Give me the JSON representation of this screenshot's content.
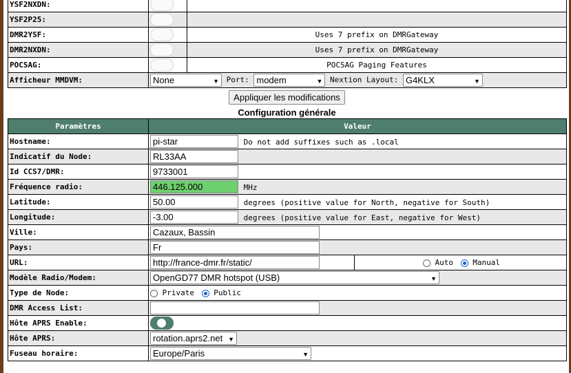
{
  "top_table": {
    "rows": [
      {
        "label": "YSF2NXDN:",
        "description": ""
      },
      {
        "label": "YSF2P25:",
        "description": ""
      },
      {
        "label": "DMR2YSF:",
        "description": "Uses 7 prefix on DMRGateway"
      },
      {
        "label": "DMR2NXDN:",
        "description": "Uses 7 prefix on DMRGateway"
      },
      {
        "label": "POCSAG:",
        "description": "POCSAG Paging Features"
      }
    ],
    "display": {
      "label": "Afficheur MMDVM:",
      "display_value": "None",
      "port_label": "Port:",
      "port_value": "modem",
      "nextion_label": "Nextion Layout:",
      "nextion_value": "G4KLX"
    }
  },
  "apply_button": "Appliquer les modifications",
  "section_title": "Configuration générale",
  "config": {
    "header_param": "Paramètres",
    "header_value": "Valeur",
    "hostname": {
      "label": "Hostname:",
      "value": "pi-star",
      "note": "Do not add suffixes such as .local"
    },
    "callsign": {
      "label": "Indicatif du Node:",
      "value": "RL33AA"
    },
    "ccs7": {
      "label": "Id CCS7/DMR:",
      "value": "9733001"
    },
    "frequency": {
      "label": "Fréquence radio:",
      "value": "446.125.000",
      "unit": "MHz"
    },
    "latitude": {
      "label": "Latitude:",
      "value": "50.00",
      "note": "degrees (positive value for North, negative for South)"
    },
    "longitude": {
      "label": "Longitude:",
      "value": "-3.00",
      "note": "degrees (positive value for East, negative for West)"
    },
    "city": {
      "label": "Ville:",
      "value": "Cazaux, Bassin"
    },
    "country": {
      "label": "Pays:",
      "value": "Fr"
    },
    "url": {
      "label": "URL:",
      "value": "http://france-dmr.fr/static/",
      "auto": "Auto",
      "manual": "Manual"
    },
    "modem": {
      "label": "Modèle Radio/Modem:",
      "value": "OpenGD77 DMR hotspot (USB)"
    },
    "node_type": {
      "label": "Type de Node:",
      "private": "Private",
      "public": "Public"
    },
    "dmr_access": {
      "label": "DMR Access List:",
      "value": ""
    },
    "aprs_enable": {
      "label": "Hôte APRS Enable:",
      "state": "on"
    },
    "aprs_host": {
      "label": "Hôte APRS:",
      "value": "rotation.aprs2.net"
    },
    "timezone": {
      "label": "Fuseau horaire:",
      "value": "Europe/Paris"
    }
  },
  "colors": {
    "accent": "#4f7e6e",
    "frequency_highlight": "#6ecf6e",
    "frame": "#6b3d1e"
  }
}
